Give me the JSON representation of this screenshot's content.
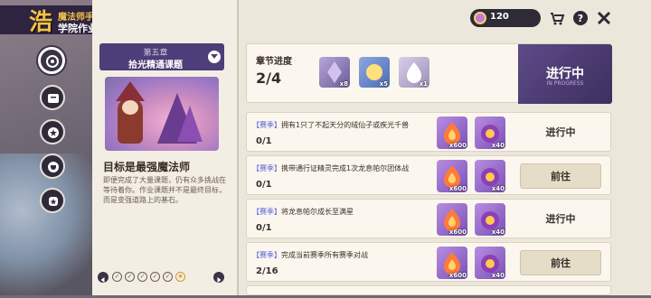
{
  "header": {
    "logo_glyph": "浩",
    "subtitle": "魔法师手册",
    "title": "学院作业"
  },
  "currency": {
    "value": "120",
    "icon": "purple-gem-icon"
  },
  "top_icons": [
    "shopping-cart-icon",
    "help-icon",
    "close-icon"
  ],
  "nav": {
    "items": [
      "overview-icon",
      "book-icon",
      "star-badge-icon",
      "trophy-icon",
      "scroll-icon"
    ]
  },
  "chapter": {
    "number": "第五章",
    "name": "拾光精通课题",
    "goal_title": "目标是最强魔法师",
    "goal_desc": "即便完成了大量课题，仍有众多挑战在等待着你。作业课题并不是最终目标，而是变强道路上的基石。"
  },
  "chapter_progress": {
    "label": "章节进度",
    "value": "2/4",
    "rewards": [
      {
        "icon": "purple-crystal-icon",
        "count": "x8"
      },
      {
        "icon": "blue-orb-icon",
        "count": "x5"
      },
      {
        "icon": "white-flame-icon",
        "count": "x1"
      }
    ],
    "status": "进行中",
    "status_sub": "IN PROGRESS"
  },
  "quests": [
    {
      "tag": "【赛季】",
      "text": "拥有1只了不起天分的绒仙子或疾光千兽",
      "progress": "0/1",
      "r1": "x600",
      "r2": "x40",
      "button": "进行中",
      "state": "in-progress"
    },
    {
      "tag": "【赛季】",
      "text": "携带通行证精灵完成1次龙息帕尔团体战",
      "progress": "0/1",
      "r1": "x600",
      "r2": "x40",
      "button": "前往",
      "state": "go"
    },
    {
      "tag": "【赛季】",
      "text": "将龙息帕尔成长至满星",
      "progress": "0/1",
      "r1": "x600",
      "r2": "x40",
      "button": "进行中",
      "state": "in-progress"
    },
    {
      "tag": "【赛季】",
      "text": "完成当前赛季所有赛季对战",
      "progress": "2/16",
      "r1": "x600",
      "r2": "x40",
      "button": "前往",
      "state": "go"
    }
  ],
  "pager": {
    "current": "★"
  },
  "colors": {
    "accent": "#4d3d78",
    "tag": "#5a5fd6",
    "reward_purple": "#7a4fb8",
    "gold": "#f1c24a"
  }
}
